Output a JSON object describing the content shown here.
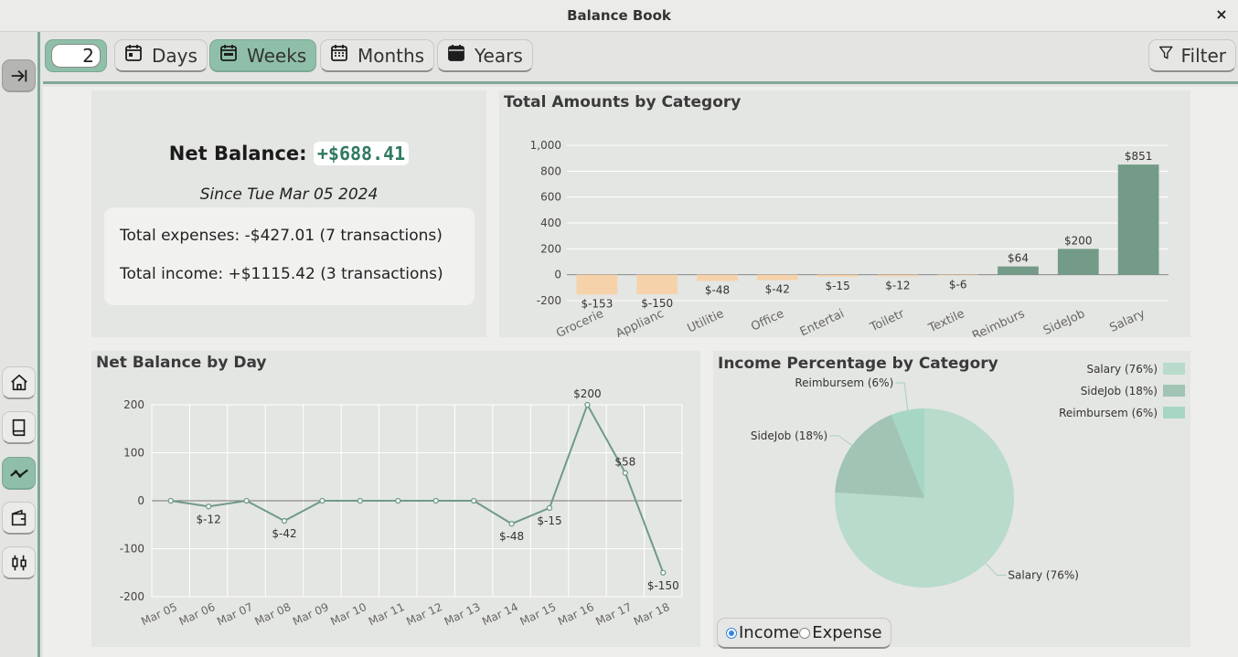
{
  "window": {
    "title": "Balance Book",
    "close_glyph": "×"
  },
  "toolbar": {
    "period_count": "2",
    "buttons": [
      {
        "label": "Days",
        "icon": "calendar-day-icon",
        "active": false
      },
      {
        "label": "Weeks",
        "icon": "calendar-week-icon",
        "active": true
      },
      {
        "label": "Months",
        "icon": "calendar-month-icon",
        "active": false
      },
      {
        "label": "Years",
        "icon": "calendar-year-icon",
        "active": false
      }
    ],
    "filter_label": "Filter"
  },
  "sidebar": {
    "items": [
      {
        "name": "collapse",
        "icon": "collapse-sidebar-icon"
      },
      {
        "name": "home",
        "icon": "home-icon"
      },
      {
        "name": "book",
        "icon": "book-icon"
      },
      {
        "name": "trends",
        "icon": "trend-icon",
        "active": true
      },
      {
        "name": "wallet",
        "icon": "wallet-icon"
      },
      {
        "name": "candles",
        "icon": "candlestick-icon"
      }
    ]
  },
  "summary": {
    "net_label": "Net Balance:",
    "net_value": "+$688.41",
    "since": "Since Tue Mar 05 2024",
    "expenses_line": "Total expenses: -$427.01 (7 transactions)",
    "income_line": "Total income: +$1115.42 (3 transactions)"
  },
  "colors": {
    "accent": "#7fa898",
    "positive_bar": "#739b87",
    "negative_bar": "#f6d2aa",
    "line": "#6f9a88",
    "pie_salary": "#b8dbcb",
    "pie_sidejob": "#a1c4b4",
    "pie_reimburse": "#a6d7c4"
  },
  "chart_data": [
    {
      "type": "bar",
      "title": "Total Amounts by Category",
      "categories": [
        "Grocerie",
        "Applianc",
        "Utilitie",
        "Office",
        "Entertai",
        "Toiletr",
        "Textile",
        "Reimburs",
        "SideJob",
        "Salary"
      ],
      "values": [
        -153,
        -150,
        -48,
        -42,
        -15,
        -12,
        -6,
        64,
        200,
        851
      ],
      "labels": [
        "$-153",
        "$-150",
        "$-48",
        "$-42",
        "$-15",
        "$-12",
        "$-6",
        "$64",
        "$200",
        "$851"
      ],
      "ylim": [
        -200,
        1000
      ],
      "yticks": [
        -200,
        0,
        200,
        400,
        600,
        800,
        1000
      ],
      "ytick_labels": [
        "-200",
        "0",
        "200",
        "400",
        "600",
        "800",
        "1,000"
      ],
      "grid": true
    },
    {
      "type": "line",
      "title": "Net Balance by Day",
      "x": [
        "Mar 05",
        "Mar 06",
        "Mar 07",
        "Mar 08",
        "Mar 09",
        "Mar 10",
        "Mar 11",
        "Mar 12",
        "Mar 13",
        "Mar 14",
        "Mar 15",
        "Mar 16",
        "Mar 17",
        "Mar 18"
      ],
      "points": [
        {
          "x": "Mar 05",
          "y": 0
        },
        {
          "x": "Mar 06",
          "y": -12
        },
        {
          "x": "Mar 07",
          "y": 0
        },
        {
          "x": "Mar 08",
          "y": -42
        },
        {
          "x": "Mar 09",
          "y": 0
        },
        {
          "x": "Mar 10",
          "y": 0
        },
        {
          "x": "Mar 11",
          "y": 0
        },
        {
          "x": "Mar 12",
          "y": 0
        },
        {
          "x": "Mar 13",
          "y": 0
        },
        {
          "x": "Mar 14",
          "y": -48
        },
        {
          "x": "Mar 15",
          "y": -15
        },
        {
          "x": "Mar 16",
          "y": 200
        },
        {
          "x": "Mar 17",
          "y": 58
        },
        {
          "x": "Mar 18",
          "y": -150
        }
      ],
      "point_labels": [
        "",
        "$-12",
        "",
        "$-42",
        "",
        "",
        "",
        "",
        "",
        "$-48",
        "$-15",
        "$200",
        "$58",
        "$-150"
      ],
      "ylim": [
        -200,
        200
      ],
      "yticks": [
        -200,
        -100,
        0,
        100,
        200
      ],
      "grid": true
    },
    {
      "type": "pie",
      "title": "Income Percentage by Category",
      "slices": [
        {
          "label": "Salary (76%)",
          "value": 76
        },
        {
          "label": "SideJob (18%)",
          "value": 18
        },
        {
          "label": "Reimbursem (6%)",
          "value": 6
        }
      ],
      "legend_position": "top-right"
    }
  ],
  "pie_toggle": {
    "income_label": "Income",
    "expense_label": "Expense",
    "selected": "Income"
  }
}
